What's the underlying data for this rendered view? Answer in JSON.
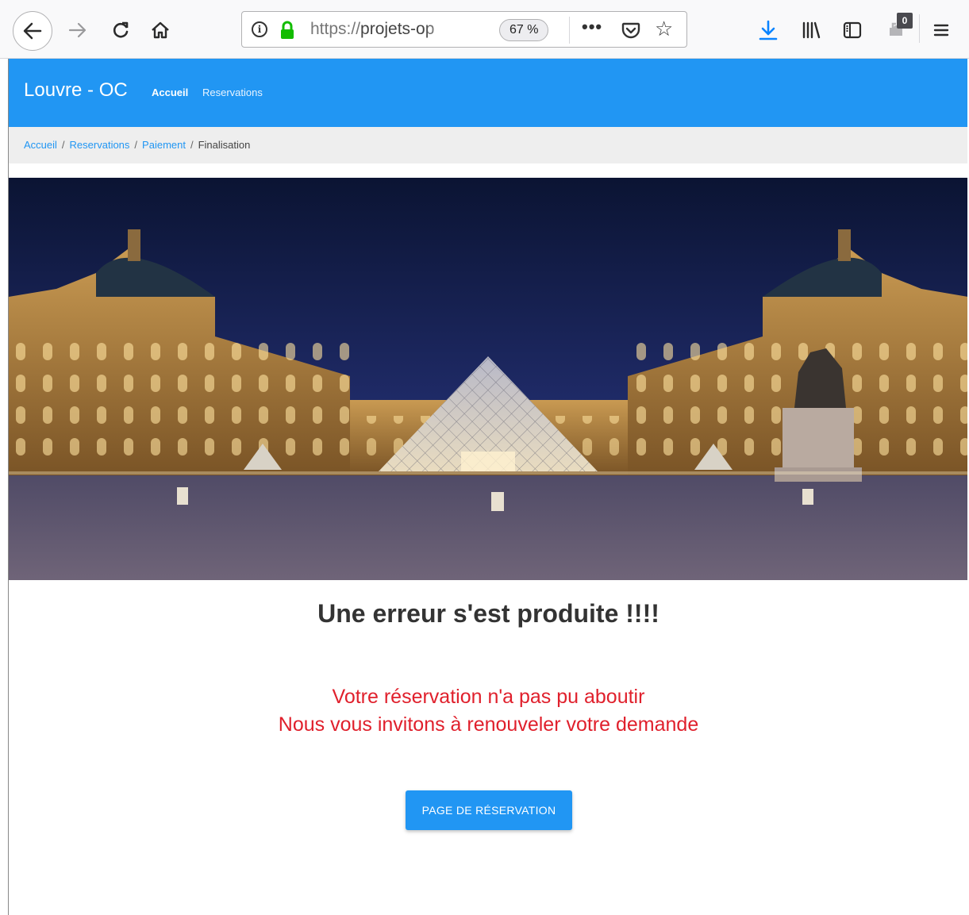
{
  "browser": {
    "url_scheme": "https://",
    "url_host": "projets-op",
    "zoom": "67 %",
    "more_label": "•••",
    "extension_badge": "0",
    "icons": [
      "back-arrow-icon",
      "forward-arrow-icon",
      "reload-icon",
      "home-icon",
      "info-icon",
      "lock-icon",
      "pocket-icon",
      "star-icon",
      "download-icon",
      "library-icon",
      "sidebar-icon",
      "extension-icon",
      "hamburger-menu-icon"
    ]
  },
  "navbar": {
    "brand": "Louvre - OC",
    "links": [
      {
        "label": "Accueil"
      },
      {
        "label": "Reservations"
      }
    ],
    "color": "#2196f3"
  },
  "breadcrumb": {
    "items": [
      "Accueil",
      "Reservations",
      "Paiement"
    ],
    "separator": "/",
    "current": "Finalisation"
  },
  "main": {
    "title": "Une erreur s'est produite !!!!",
    "message_line1": "Votre réservation n'a pas pu aboutir",
    "message_line2": "Nous vous invitons à renouveler votre demande",
    "message_color": "#e0202c",
    "button_label": "PAGE DE RÉSERVATION"
  }
}
